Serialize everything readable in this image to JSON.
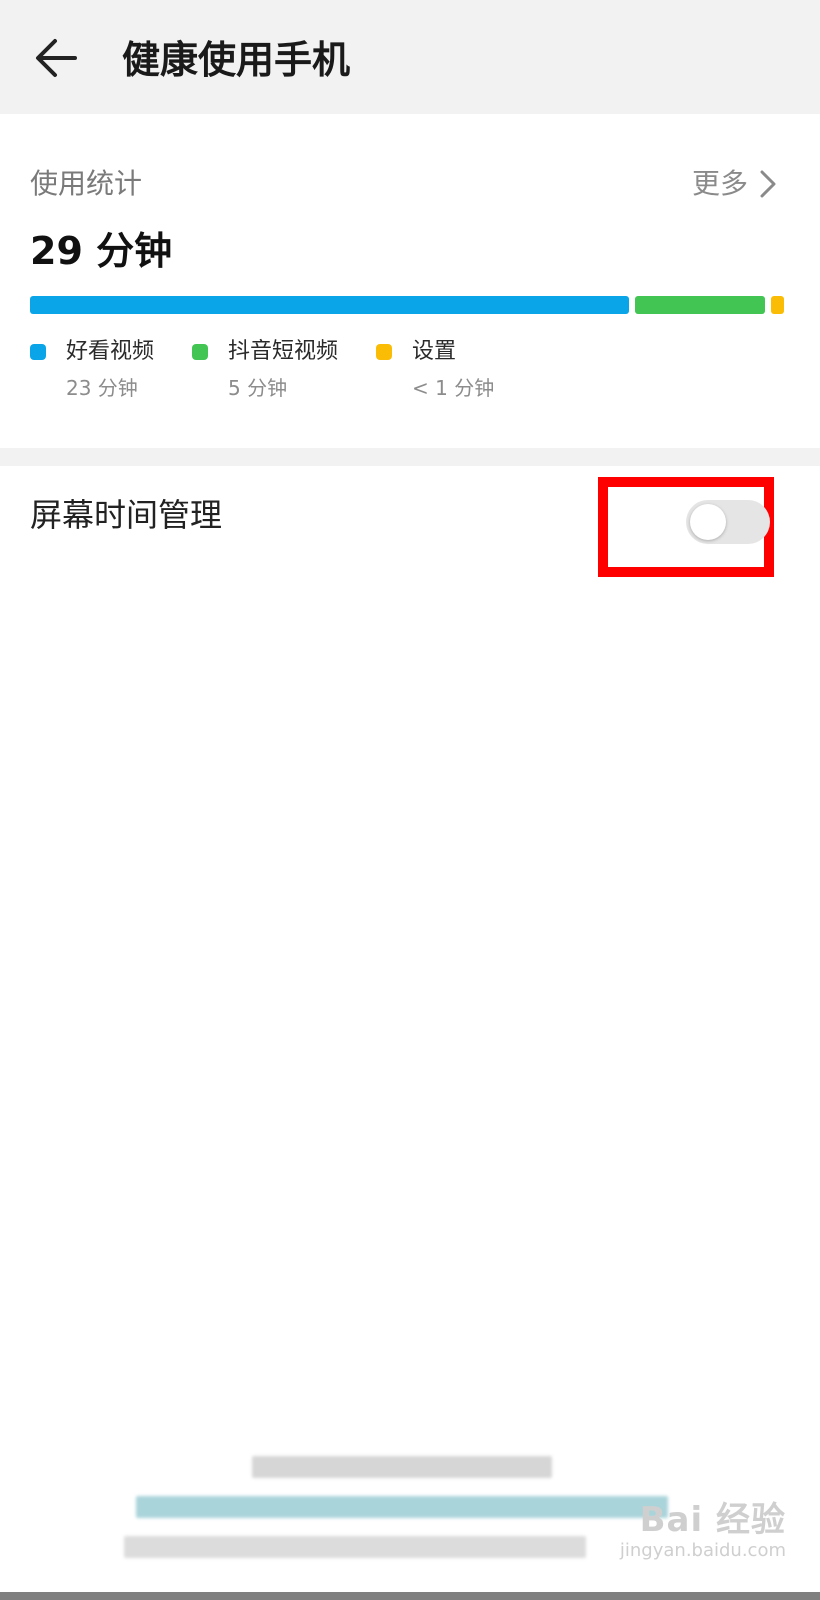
{
  "header": {
    "back_icon": "arrow-left-icon",
    "title": "健康使用手机"
  },
  "stats": {
    "section_title": "使用统计",
    "more_label": "更多",
    "more_icon": "chevron-right-icon",
    "total_time": "29 分钟",
    "apps": [
      {
        "name": "好看视频",
        "time": "23 分钟",
        "minutes": 23,
        "color": "#0aa5e8"
      },
      {
        "name": "抖音短视频",
        "time": "5 分钟",
        "minutes": 5,
        "color": "#43c553"
      },
      {
        "name": "设置",
        "time": "< 1 分钟",
        "minutes": 0.5,
        "color": "#fbbc05"
      }
    ]
  },
  "settings": {
    "screen_time_label": "屏幕时间管理",
    "screen_time_enabled": false
  },
  "colors": {
    "highlight": "#ff0000",
    "app_bar_bg": "#f2f2f2"
  },
  "watermark": {
    "main": "Bai 经验",
    "sub": "jingyan.baidu.com"
  }
}
